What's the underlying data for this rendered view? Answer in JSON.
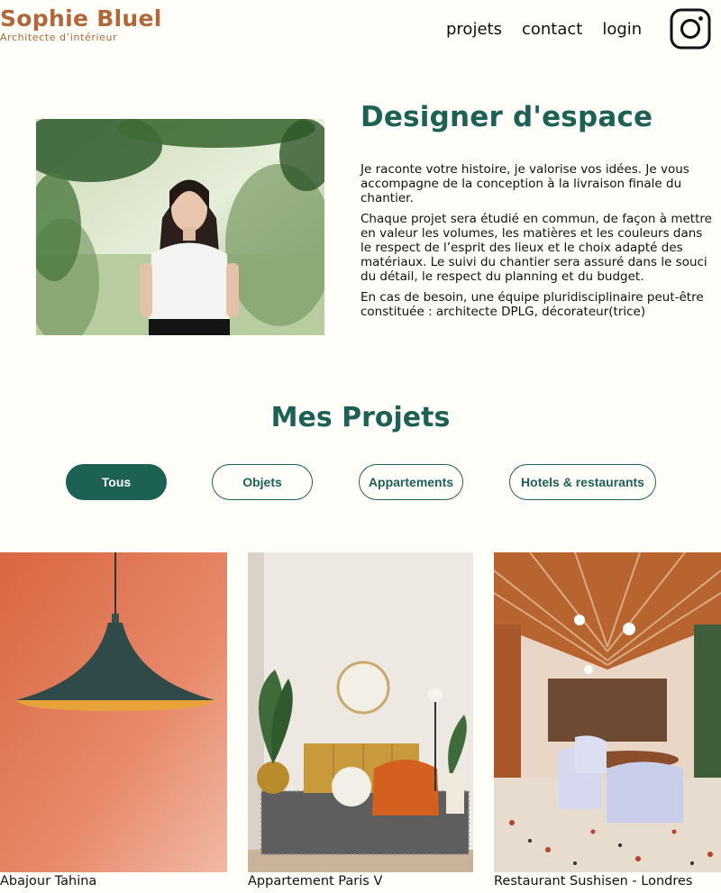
{
  "header": {
    "brand_name": "Sophie Bluel",
    "brand_tagline": "Architecte d’intérieur",
    "nav": [
      "projets",
      "contact",
      "login"
    ],
    "social_icon": "instagram-icon"
  },
  "intro": {
    "photo_alt": "",
    "title": "Designer d'espace",
    "paragraphs": [
      "Je raconte votre histoire, je valorise vos idées. Je vous accompagne de la conception à la livraison finale du chantier.",
      "Chaque projet sera étudié en commun, de façon à mettre en valeur les volumes, les matières et les couleurs dans le respect de l’esprit des lieux et le choix adapté des matériaux. Le suivi du chantier sera assuré dans le souci du détail, le respect du planning et du budget.",
      "En cas de besoin, une équipe pluridisciplinaire peut-être constituée : architecte DPLG, décorateur(trice)"
    ]
  },
  "portfolio": {
    "title": "Mes Projets",
    "filters": [
      "Tous",
      "Objets",
      "Appartements",
      "Hotels & restaurants"
    ],
    "active_filter": "Tous",
    "projects": [
      {
        "caption": "Abajour Tahina"
      },
      {
        "caption": "Appartement Paris V"
      },
      {
        "caption": "Restaurant Sushisen - Londres"
      }
    ]
  },
  "colors": {
    "accent": "#1D6154",
    "brand": "#B1663C",
    "background": "#FFFEF8"
  }
}
